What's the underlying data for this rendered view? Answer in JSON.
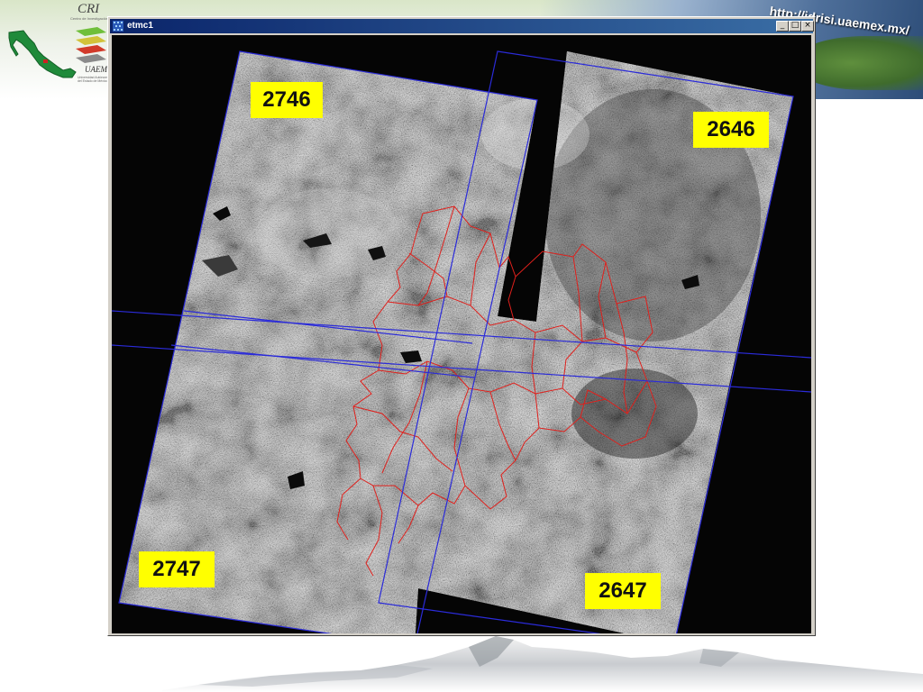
{
  "slide": {
    "url": "http://idrisi.uaemex.mx/",
    "logo": {
      "title": "CRI",
      "subtitle": "Centro de Investigación",
      "university": "UAEMex",
      "university_sub": "Universidad Autónoma del Estado de México"
    }
  },
  "window": {
    "title": "etmc1",
    "controls": {
      "minimize": "_",
      "maximize": "□",
      "close": "×"
    }
  },
  "image": {
    "scenes": [
      {
        "id": "2746",
        "label": "2746"
      },
      {
        "id": "2646",
        "label": "2646"
      },
      {
        "id": "2747",
        "label": "2747"
      },
      {
        "id": "2647",
        "label": "2647"
      }
    ],
    "colors": {
      "footprint": "#2b2bd9",
      "boundaries": "#e0201c",
      "label_bg": "#ffff00",
      "background": "#050505"
    }
  }
}
